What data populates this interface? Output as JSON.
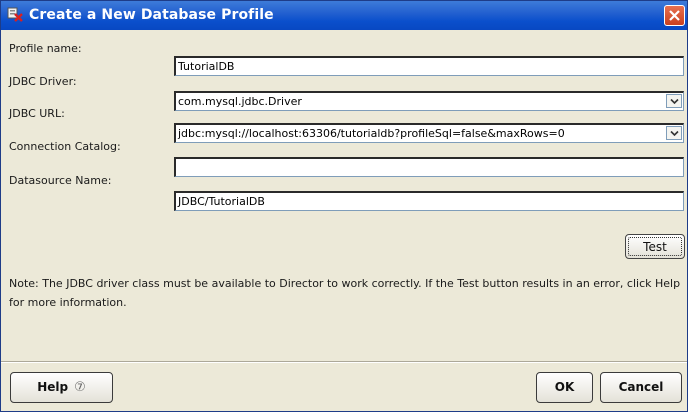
{
  "window": {
    "title": "Create a New Database Profile"
  },
  "form": {
    "profile_name": {
      "label": "Profile name:",
      "value": "TutorialDB"
    },
    "jdbc_driver": {
      "label": "JDBC Driver:",
      "value": "com.mysql.jdbc.Driver"
    },
    "jdbc_url": {
      "label": "JDBC URL:",
      "value": "jdbc:mysql://localhost:63306/tutorialdb?profileSql=false&maxRows=0"
    },
    "connection_catalog": {
      "label": "Connection Catalog:",
      "value": ""
    },
    "datasource_name": {
      "label": "Datasource Name:",
      "value": "JDBC/TutorialDB"
    }
  },
  "test_button": {
    "label": "Test"
  },
  "note": "Note: The JDBC driver class must be available to Director to work correctly. If the Test button results in an error, click Help for more information.",
  "footer": {
    "help_label": "Help",
    "help_symbol": "⑦",
    "ok_label": "OK",
    "cancel_label": "Cancel"
  },
  "icons": {
    "app": "database-profile-icon",
    "close": "close-icon",
    "dropdown": "chevron-down-icon",
    "help": "help-circle-icon"
  },
  "colors": {
    "titlebar": "#0a4fcc",
    "close_button": "#d8542d",
    "dialog_background": "#ece9d8"
  }
}
